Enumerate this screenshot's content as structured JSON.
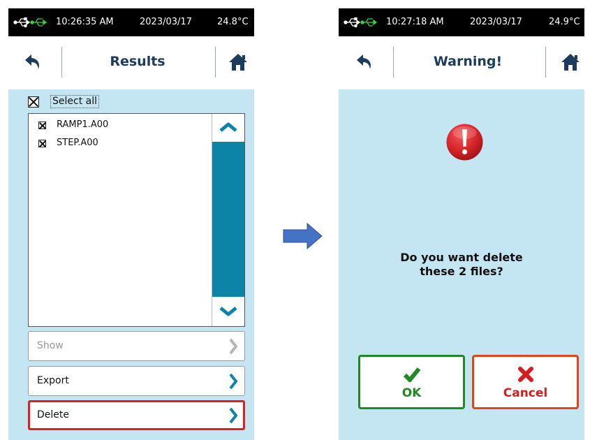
{
  "left_screen": {
    "status": {
      "time": "10:26:35 AM",
      "date": "2023/03/17",
      "temperature": "24.8°C"
    },
    "header": {
      "title": "Results"
    },
    "select_all": {
      "label": "Select all",
      "checked": true
    },
    "files": [
      {
        "name": "RAMP1.A00",
        "checked": true
      },
      {
        "name": "STEP.A00",
        "checked": true
      }
    ],
    "actions": [
      {
        "label": "Show",
        "enabled": false
      },
      {
        "label": "Export",
        "enabled": true
      },
      {
        "label": "Delete",
        "enabled": true,
        "highlighted": true
      }
    ]
  },
  "right_screen": {
    "status": {
      "time": "10:27:18 AM",
      "date": "2023/03/17",
      "temperature": "24.9°C"
    },
    "header": {
      "title": "Warning!"
    },
    "message_line1": "Do you want delete",
    "message_line2": "these 2 files?",
    "ok_label": "OK",
    "cancel_label": "Cancel"
  },
  "colors": {
    "accent_teal": "#0b84a8",
    "header_title": "#1d3c5c",
    "content_bg": "#c4e6f2",
    "highlight_red": "#e11e1e",
    "ok_green": "#1f8a23",
    "cancel_red": "#d41e1e",
    "flow_arrow": "#4472c4"
  },
  "icons": {
    "usb": "usb-icon",
    "back": "back-arrow-icon",
    "home": "home-icon",
    "scroll_up": "chevron-up-icon",
    "scroll_down": "chevron-down-icon",
    "button_arrow": "chevron-right-icon",
    "warning": "warning-exclamation-icon",
    "ok": "checkmark-icon",
    "cancel": "x-icon",
    "flow": "right-arrow-icon"
  }
}
